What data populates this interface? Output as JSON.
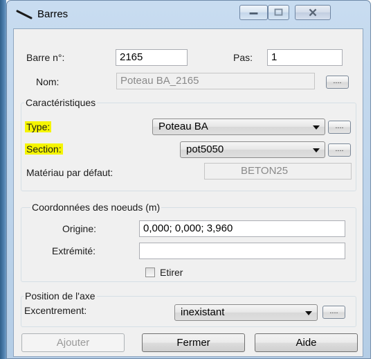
{
  "window": {
    "title": "Barres"
  },
  "form": {
    "barre_label": "Barre n°:",
    "barre_value": "2165",
    "pas_label": "Pas:",
    "pas_value": "1",
    "nom_label": "Nom:",
    "nom_value": "Poteau BA_2165",
    "browse_label": "...."
  },
  "caracteristiques": {
    "title": "Caractéristiques",
    "type_label": "Type:",
    "type_value": "Poteau BA",
    "section_label": "Section:",
    "section_value": "pot5050",
    "materiau_label": "Matériau par défaut:",
    "materiau_value": "BETON25"
  },
  "coordonnees": {
    "title": "Coordonnées des noeuds (m)",
    "origine_label": "Origine:",
    "origine_value": "0,000; 0,000; 3,960",
    "extremite_label": "Extrémité:",
    "extremite_value": "",
    "etirer_label": "Etirer"
  },
  "axe": {
    "title": "Position de l'axe",
    "excentrement_label": "Excentrement:",
    "excentrement_value": "inexistant"
  },
  "buttons": {
    "ajouter": "Ajouter",
    "fermer": "Fermer",
    "aide": "Aide"
  },
  "highlight_color": "#f5f500",
  "icons": [
    "bar-app-icon",
    "minimize-icon",
    "maximize-icon",
    "close-icon",
    "dropdown-arrow-icon",
    "checkbox-icon"
  ]
}
